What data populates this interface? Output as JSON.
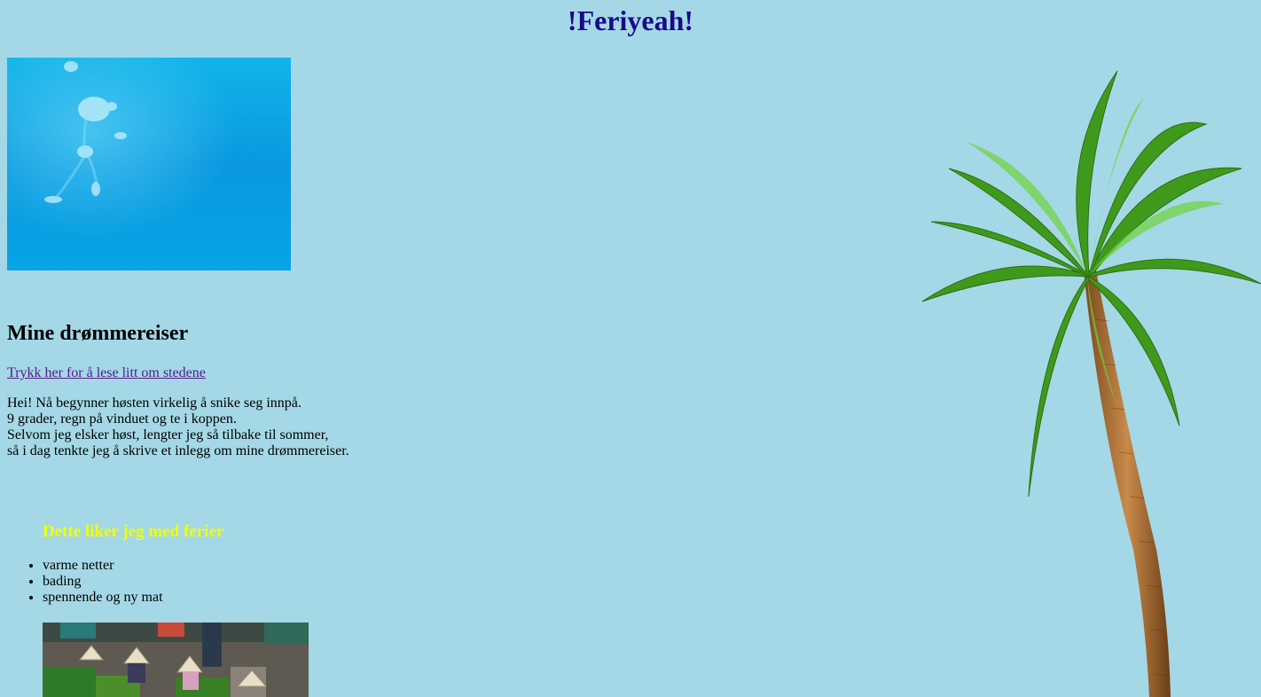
{
  "header": {
    "title": "!Feriyeah!"
  },
  "main": {
    "heading": "Mine drømmereiser",
    "link_text": "Trykk her for å lese litt om stedene",
    "intro_lines": [
      "Hei! Nå begynner høsten virkelig å snike seg innpå.",
      "9 grader, regn på vinduet og te i koppen.",
      "Selvom jeg elsker høst, lengter jeg så tilbake til sommer,",
      "så i dag tenkte jeg å skrive et inlegg om mine drømmereiser."
    ]
  },
  "likes": {
    "heading": "Dette liker jeg med ferier",
    "items": [
      "varme netter",
      "bading",
      "spennende og ny mat"
    ]
  },
  "colors": {
    "background": "#a4d8e6",
    "title": "#1a0a8c",
    "likes_heading": "#f2ff00",
    "link": "#551a8b"
  },
  "images": {
    "top_photo": "underwater-swimmer-photo",
    "side_decoration": "palm-tree-image",
    "bottom_photo": "market-vendors-photo"
  }
}
